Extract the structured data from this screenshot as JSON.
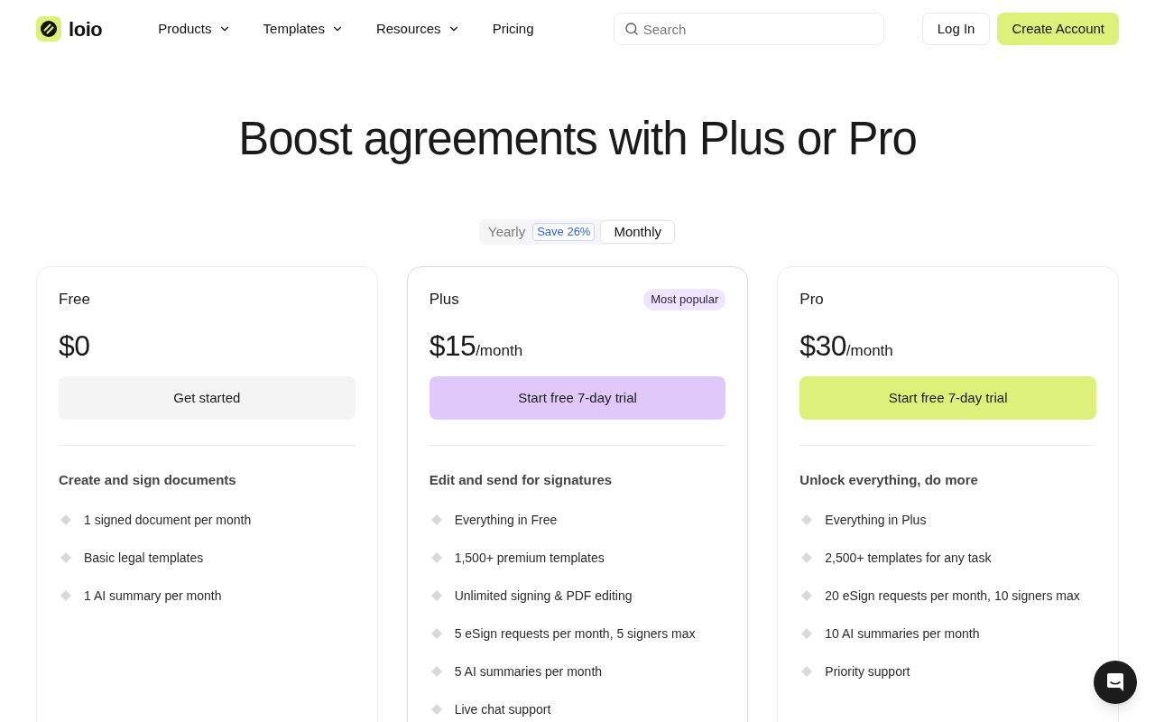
{
  "nav": {
    "brand": "loio",
    "menu": [
      {
        "label": "Products",
        "dropdown": true
      },
      {
        "label": "Templates",
        "dropdown": true
      },
      {
        "label": "Resources",
        "dropdown": true
      },
      {
        "label": "Pricing",
        "dropdown": false
      }
    ],
    "search": {
      "placeholder": "Search"
    },
    "buttons": [
      {
        "label": "Log In",
        "kind": "outline"
      },
      {
        "label": "Create Account",
        "kind": "primary"
      }
    ]
  },
  "hero": {
    "title": "Boost agreements with Plus or Pro"
  },
  "billing_toggle": [
    {
      "label": "Yearly",
      "badge": "Save 26%",
      "selected": false
    },
    {
      "label": "Monthly",
      "selected": true
    }
  ],
  "plans": [
    {
      "name": "Free",
      "price": "$0",
      "button": "Get started",
      "color": "#f4f4f4",
      "highlighted": false,
      "subtitle": "Create and sign documents",
      "features": [
        "1 signed document per month",
        "Basic legal templates",
        "1 AI summary per month"
      ]
    },
    {
      "name": "Plus",
      "badge": "Most popular",
      "price": "$15",
      "period": "/month",
      "button": "Start free 7-day trial",
      "color": "#e0c8fb",
      "highlighted": true,
      "subtitle": "Edit and send for signatures",
      "features": [
        "Everything in Free",
        "1,500+ premium templates",
        "Unlimited signing & PDF editing",
        "5 eSign requests per month, 5 signers max",
        "5 AI summaries per month",
        "Live chat support"
      ]
    },
    {
      "name": "Pro",
      "price": "$30",
      "period": "/month",
      "button": "Start free 7-day trial",
      "color": "#dcf07a",
      "highlighted": false,
      "subtitle": "Unlock everything, do more",
      "features": [
        "Everything in Plus",
        "2,500+ templates for any task",
        "20 eSign requests per month, 10 signers max",
        "10 AI summaries per month",
        "Priority support"
      ]
    }
  ]
}
